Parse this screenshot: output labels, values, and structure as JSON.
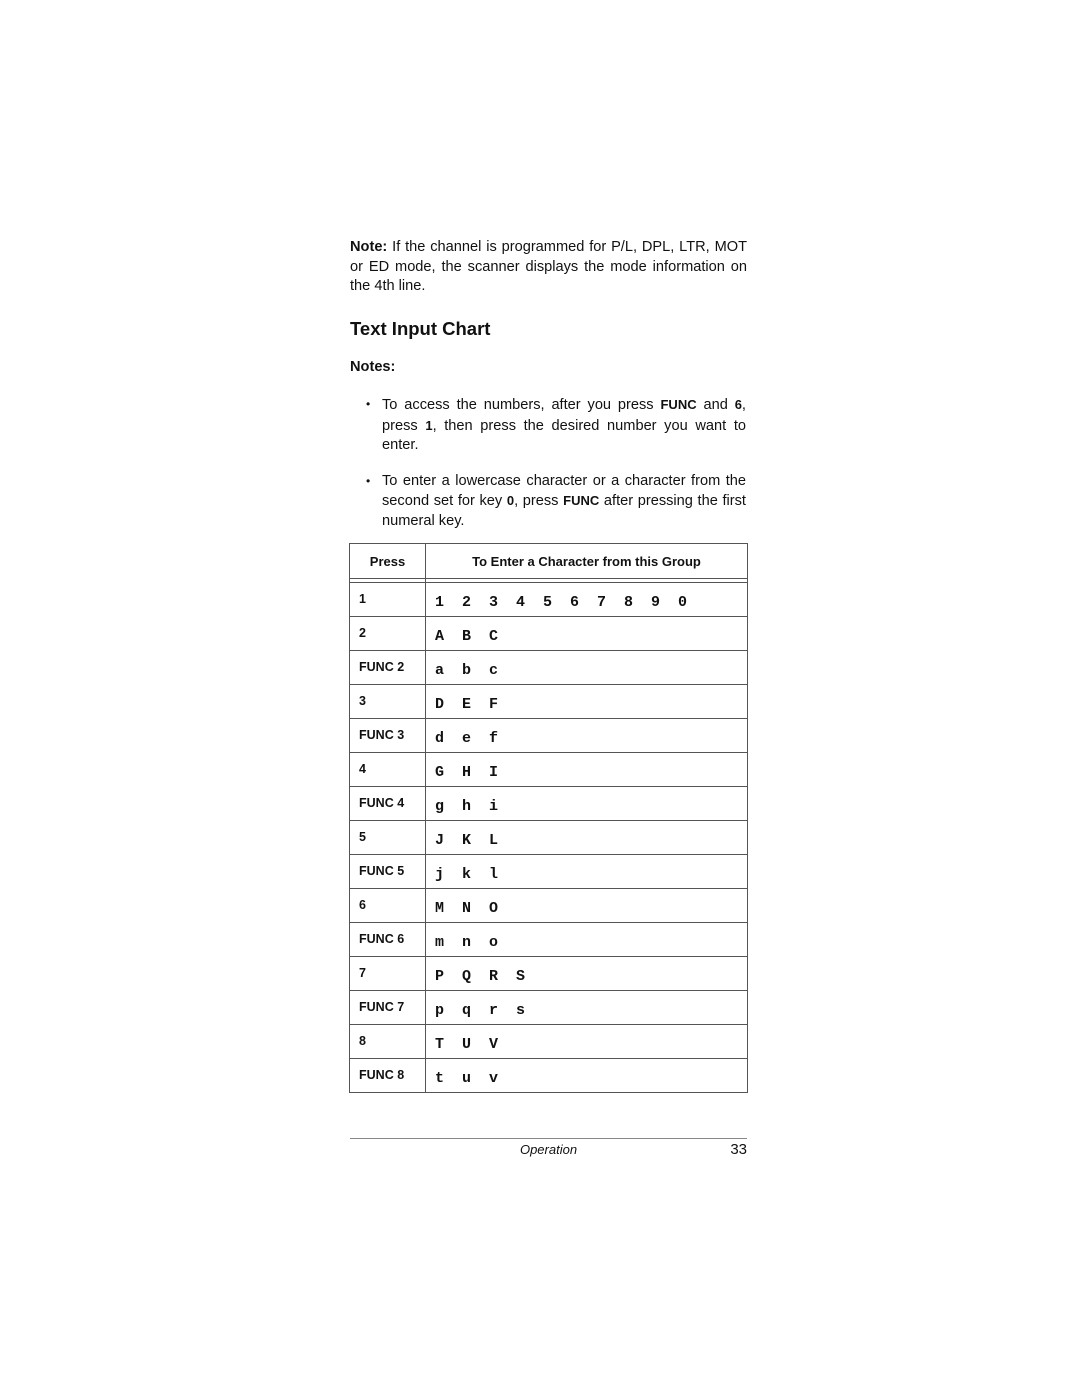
{
  "note": {
    "label": "Note:",
    "text": " If the channel is programmed for P/L, DPL, LTR, MOT or ED mode, the scanner displays the mode information on the 4th line."
  },
  "section_title": "Text Input Chart",
  "notes_label": "Notes:",
  "bullets": [
    {
      "parts": [
        "To access the numbers, after you press ",
        "FUNC",
        " and ",
        "6",
        ", press ",
        "1",
        ", then press the desired number you want to enter."
      ]
    },
    {
      "parts": [
        "To enter a lowercase character or a character from the second set for key ",
        "0",
        ", press ",
        "FUNC",
        " after pressing the first numeral key."
      ]
    }
  ],
  "table": {
    "headers": [
      "Press",
      "To Enter a Character from this Group"
    ],
    "rows": [
      {
        "press": "1",
        "chars": "1 2 3 4 5 6 7 8 9 0"
      },
      {
        "press": "2",
        "chars": "A B C"
      },
      {
        "press": "FUNC 2",
        "chars": "a b c"
      },
      {
        "press": "3",
        "chars": "D E F"
      },
      {
        "press": "FUNC 3",
        "chars": "d e f"
      },
      {
        "press": "4",
        "chars": "G H I"
      },
      {
        "press": "FUNC 4",
        "chars": "g h i"
      },
      {
        "press": "5",
        "chars": "J K L"
      },
      {
        "press": "FUNC 5",
        "chars": "j k l"
      },
      {
        "press": "6",
        "chars": "M N O"
      },
      {
        "press": "FUNC 6",
        "chars": "m n o"
      },
      {
        "press": "7",
        "chars": "P Q R S"
      },
      {
        "press": "FUNC 7",
        "chars": "p q r s"
      },
      {
        "press": "8",
        "chars": "T U V"
      },
      {
        "press": "FUNC 8",
        "chars": "t u v"
      }
    ]
  },
  "footer": {
    "section": "Operation",
    "page_number": "33"
  }
}
